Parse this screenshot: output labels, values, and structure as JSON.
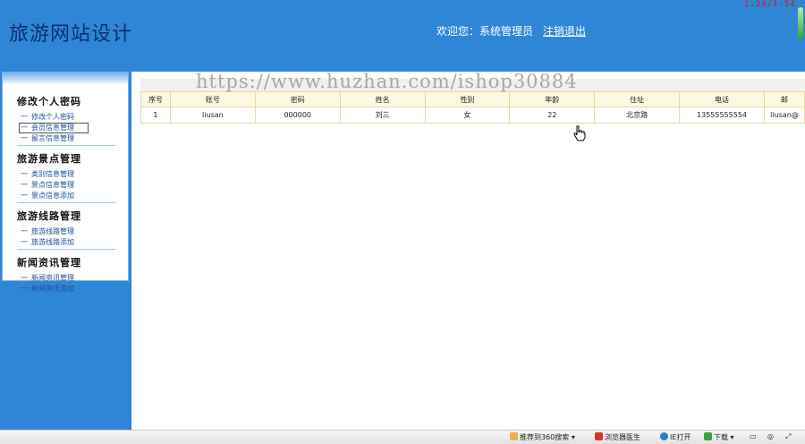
{
  "header": {
    "site_title": "旅游网站设计",
    "welcome": "欢迎您：系统管理员",
    "logout": "注销退出",
    "clock": "1:24/1:54"
  },
  "sidebar": {
    "groups": [
      {
        "title": "修改个人密码",
        "items": [
          "修改个人密码",
          "会员信息管理",
          "留言信息管理"
        ]
      },
      {
        "title": "旅游景点管理",
        "items": [
          "类别信息管理",
          "景点信息管理",
          "景点信息添加"
        ]
      },
      {
        "title": "旅游线路管理",
        "items": [
          "旅游线路管理",
          "旅游线路添加"
        ]
      },
      {
        "title": "新闻资讯管理",
        "items": [
          "新闻资讯管理",
          "新闻资讯添加"
        ]
      }
    ]
  },
  "watermark": "https://www.huzhan.com/ishop30884",
  "table": {
    "headers": [
      "序号",
      "账号",
      "密码",
      "姓名",
      "性别",
      "年龄",
      "住址",
      "电话",
      "邮"
    ],
    "rows": [
      [
        "1",
        "liusan",
        "000000",
        "刘三",
        "女",
        "22",
        "北京路",
        "13555555554",
        "liusan@"
      ]
    ]
  },
  "statusbar": {
    "search360": "推荐到360搜索",
    "browser_doctor": "浏览器医生",
    "ie_open": "IE打开",
    "download": "下载"
  },
  "colors": {
    "page_bg": "#2f86d6",
    "title": "#0d2f6e",
    "clock": "#e01010",
    "table_border": "#e8d9a0"
  }
}
